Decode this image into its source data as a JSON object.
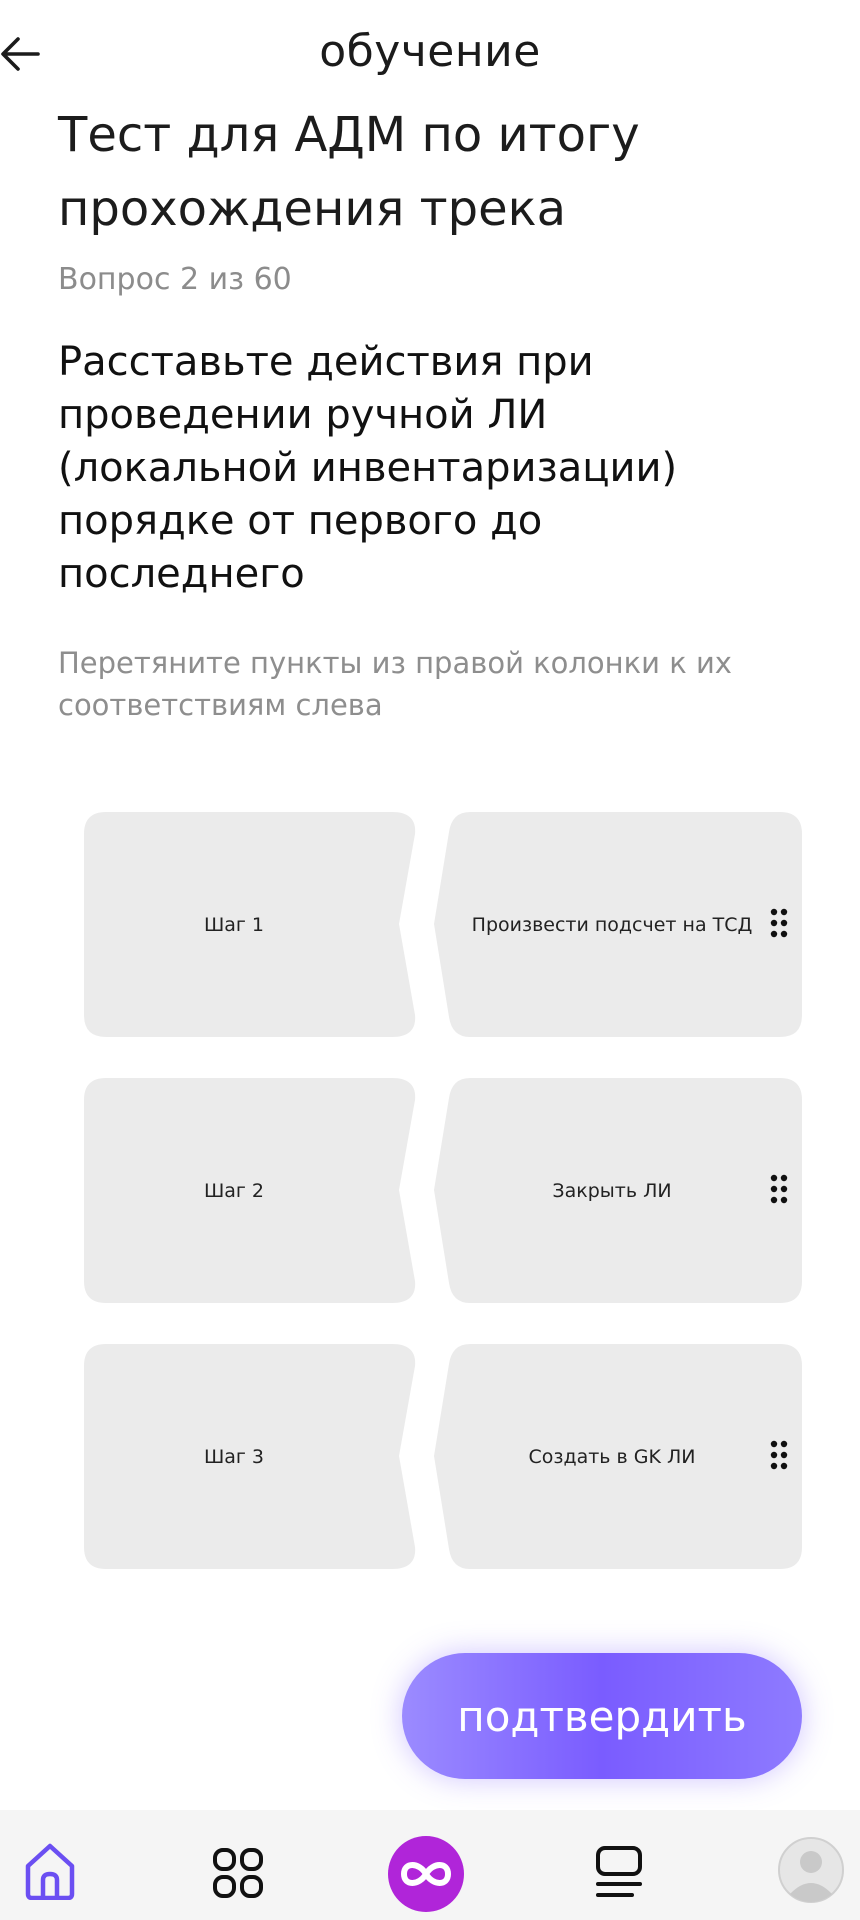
{
  "header": {
    "back_icon": "arrow-left-icon",
    "title": "обучение"
  },
  "test": {
    "title": "Тест для АДМ по итогу прохождения трека",
    "counter": "Вопрос 2 из 60",
    "question": "Расставьте действия при проведении ручной ЛИ (локальной инвентаризации) порядке от первого до последнего",
    "hint": "Перетяните пункты из правой колонки к их соответствиям слева"
  },
  "pairs": [
    {
      "step": "Шаг 1",
      "answer": "Произвести подсчет на ТСД"
    },
    {
      "step": "Шаг 2",
      "answer": "Закрыть ЛИ"
    },
    {
      "step": "Шаг 3",
      "answer": "Создать в GK ЛИ"
    }
  ],
  "confirm_label": "подтвердить",
  "nav": {
    "items": [
      {
        "name": "home",
        "icon": "home-icon",
        "active": true
      },
      {
        "name": "catalog",
        "icon": "grid-icon",
        "active": false
      },
      {
        "name": "center",
        "icon": "infinity-icon",
        "active": false
      },
      {
        "name": "tasks",
        "icon": "list-icon",
        "active": false
      },
      {
        "name": "profile",
        "icon": "avatar-icon",
        "active": false
      }
    ]
  },
  "colors": {
    "card_bg": "#ebebeb",
    "accent": "#7b5cff",
    "nav_active": "#6b4ff2",
    "center_button": "#b025d9"
  }
}
